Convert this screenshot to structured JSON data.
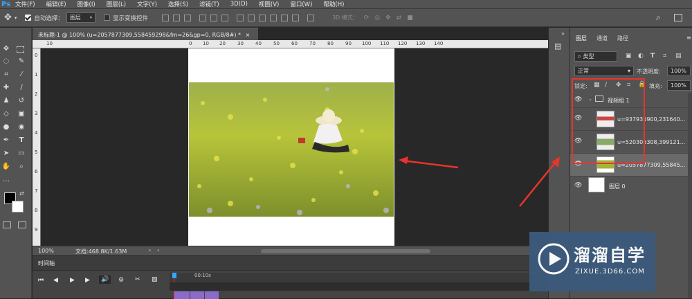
{
  "app": {
    "logo": "Ps"
  },
  "menu": [
    "文件(F)",
    "编辑(E)",
    "图像(I)",
    "图层(L)",
    "文字(Y)",
    "选择(S)",
    "滤镜(T)",
    "3D(D)",
    "视图(V)",
    "窗口(W)",
    "帮助(H)"
  ],
  "options": {
    "auto_select_label": "自动选择：",
    "auto_select_value": "图层",
    "show_transform_label": "显示变换控件",
    "mode_3d_label": "3D 模式："
  },
  "document": {
    "tab_title": "未标题-1 @ 100% (u=2057877309,558459298&fm=26&gp=0, RGB/8#) *",
    "zoom": "100%",
    "doc_info": "文档:468.8K/1.63M"
  },
  "ruler": {
    "h_ticks": [
      "10",
      "0",
      "10",
      "20",
      "30",
      "40",
      "50",
      "60",
      "70",
      "80",
      "90",
      "100",
      "110",
      "120",
      "130",
      "140"
    ],
    "v_ticks": [
      "0",
      "1",
      "2",
      "3",
      "4",
      "5",
      "6",
      "7",
      "8",
      "9"
    ]
  },
  "timeline": {
    "tab_label": "时间轴",
    "time_label": "00:10s"
  },
  "layers_panel": {
    "tabs": [
      "图层",
      "通道",
      "路径"
    ],
    "filter_label": "类型",
    "blend_mode": "正常",
    "opacity_label": "不透明度:",
    "opacity_value": "100%",
    "lock_label": "锁定:",
    "fill_label": "填充:",
    "fill_value": "100%",
    "group_name": "视频组 1",
    "layers": [
      {
        "name": "u=937935900,231640..."
      },
      {
        "name": "u=520306308,399121..."
      },
      {
        "name": "u=2057877309,55845..."
      },
      {
        "name": "图层 0"
      }
    ]
  },
  "watermark": {
    "title": "溜溜自学",
    "url": "ZIXUE.3D66.COM"
  },
  "colors": {
    "accent_blue": "#31a8ff",
    "annotation_red": "#e8342c",
    "panel_bg": "#535353",
    "selected_row": "#6a6a6a"
  }
}
